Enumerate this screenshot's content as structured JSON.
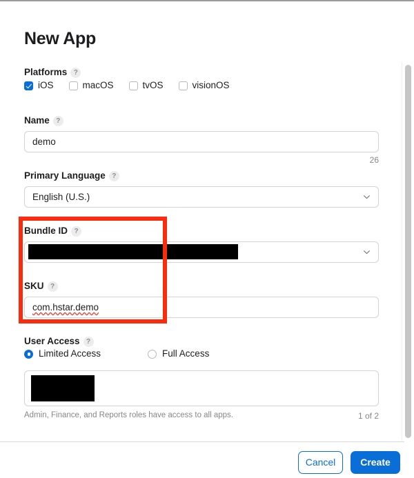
{
  "page": {
    "title": "New App"
  },
  "platforms": {
    "label": "Platforms",
    "help": "?",
    "options": [
      {
        "label": "iOS",
        "checked": true
      },
      {
        "label": "macOS",
        "checked": false
      },
      {
        "label": "tvOS",
        "checked": false
      },
      {
        "label": "visionOS",
        "checked": false
      }
    ]
  },
  "name": {
    "label": "Name",
    "help": "?",
    "value": "demo",
    "counter": "26"
  },
  "primary_language": {
    "label": "Primary Language",
    "help": "?",
    "value": "English (U.S.)",
    "chevron": "chevron-down-icon"
  },
  "bundle_id": {
    "label": "Bundle ID",
    "help": "?",
    "value": "",
    "redacted": true,
    "chevron": "chevron-down-icon"
  },
  "sku": {
    "label": "SKU",
    "help": "?",
    "value": "com.hstar.demo"
  },
  "user_access": {
    "label": "User Access",
    "help": "?",
    "options": [
      {
        "label": "Limited Access",
        "selected": true
      },
      {
        "label": "Full Access",
        "selected": false
      }
    ],
    "list_redacted": true,
    "helper_text": "Admin, Finance, and Reports roles have access to all apps.",
    "pager": "1 of 2"
  },
  "footer": {
    "cancel_label": "Cancel",
    "create_label": "Create"
  },
  "annotation": {
    "name": "red-highlight-rectangle",
    "color": "#f92d0d"
  },
  "colors": {
    "accent": "#0a6ed7",
    "border": "#d2d2d7",
    "muted_text": "#86868b",
    "annotation": "#f92d0d",
    "redaction": "#000000"
  }
}
